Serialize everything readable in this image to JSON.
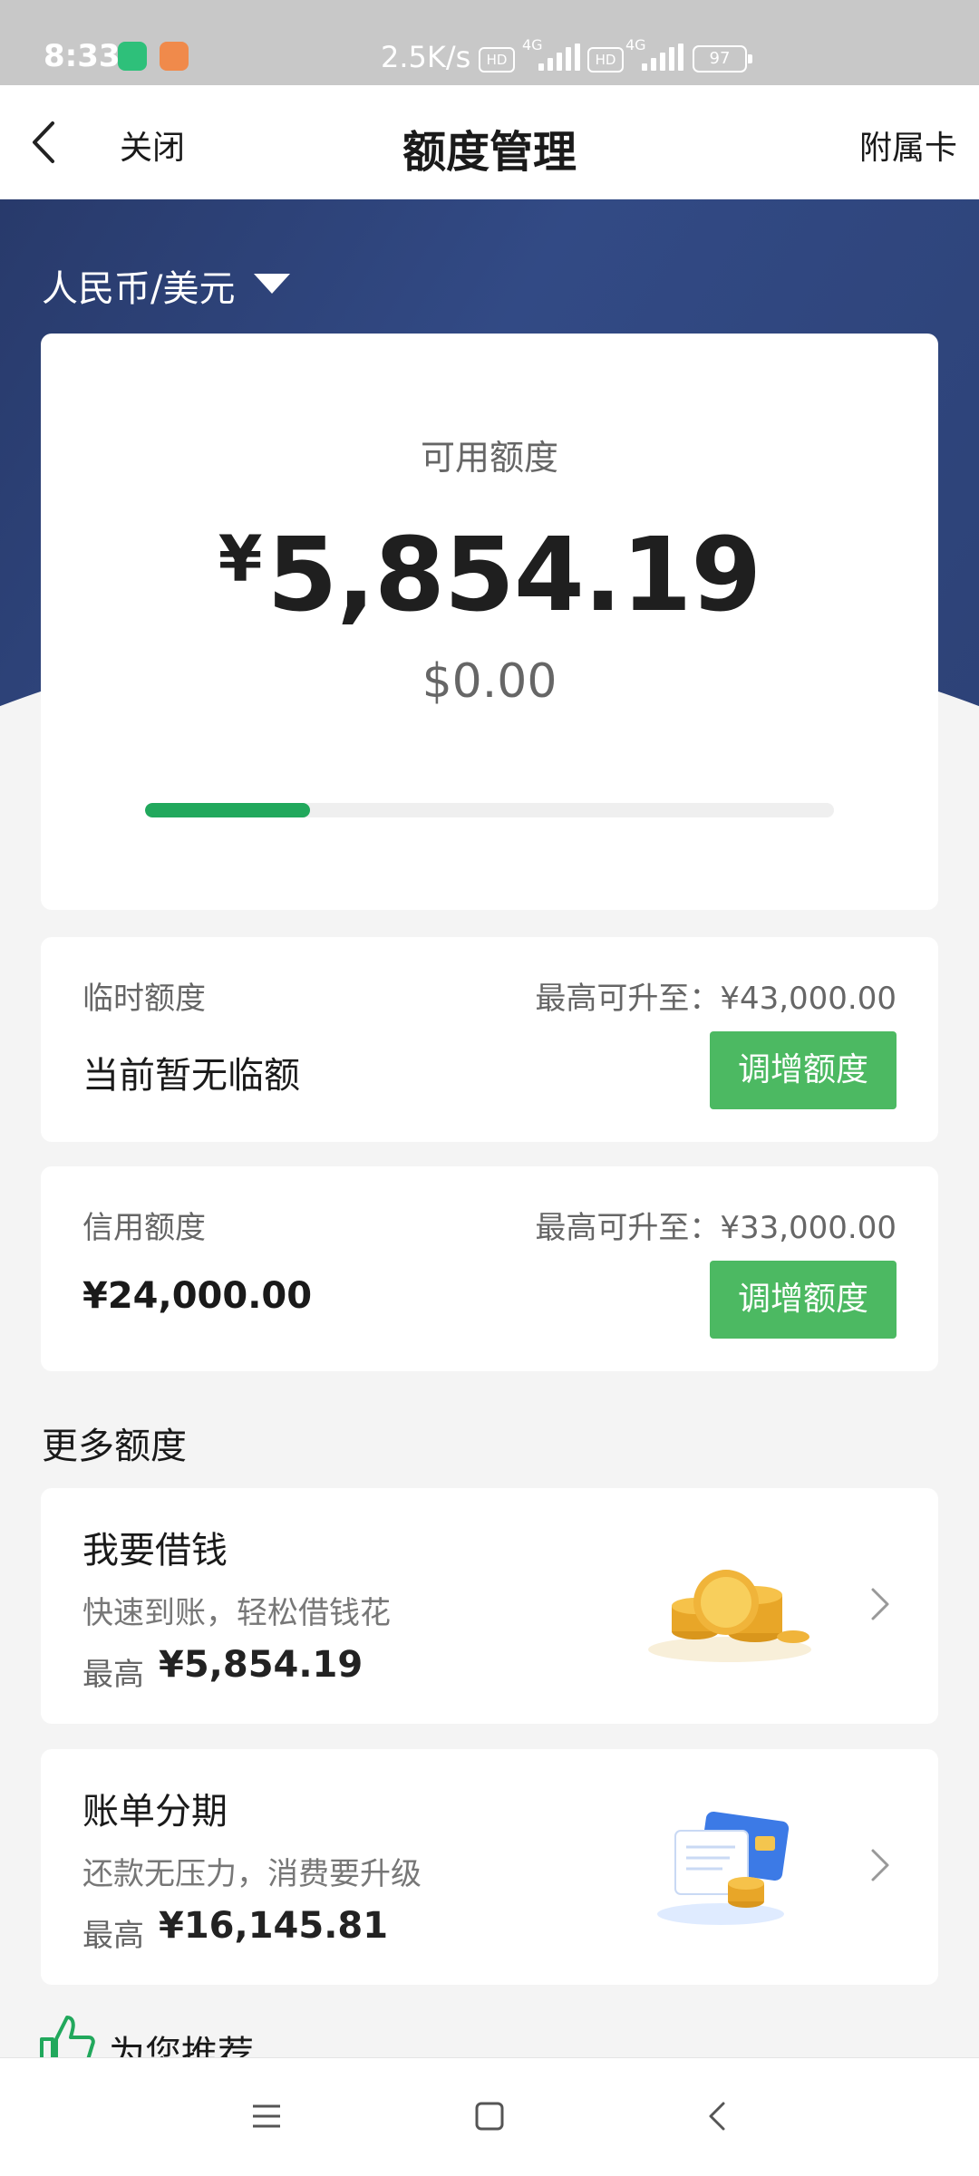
{
  "status_bar": {
    "time": "8:33",
    "net_speed": "2.5K/s",
    "hd1": "HD",
    "hd2": "HD",
    "net1": "4G",
    "net2": "4G",
    "battery": "97"
  },
  "nav": {
    "close_label": "关闭",
    "title": "额度管理",
    "right_label": "附属卡"
  },
  "currency_selector": "人民币/美元",
  "available": {
    "label": "可用额度",
    "currency_symbol": "¥",
    "amount": "5,854.19",
    "usd": "$0.00",
    "usage_fraction": 0.24
  },
  "temp_limit": {
    "title": "临时额度",
    "max_text": "最高可升至：¥43,000.00",
    "value": "当前暂无临额",
    "button": "调增额度"
  },
  "credit_limit": {
    "title": "信用额度",
    "max_text": "最高可升至：¥33,000.00",
    "value": "¥24,000.00",
    "button": "调增额度"
  },
  "more_section_title": "更多额度",
  "promos": [
    {
      "title": "我要借钱",
      "subtitle": "快速到账，轻松借钱花",
      "max_label": "最高",
      "max_value": "¥5,854.19",
      "icon": "gold-coins-icon"
    },
    {
      "title": "账单分期",
      "subtitle": "还款无压力，消费要升级",
      "max_label": "最高",
      "max_value": "¥16,145.81",
      "icon": "bill-card-coins-icon"
    }
  ],
  "recommend_title": "为您推荐",
  "colors": {
    "accent_green": "#4cb962",
    "progress_green": "#21a85c",
    "hero_navy": "#2d4277"
  }
}
